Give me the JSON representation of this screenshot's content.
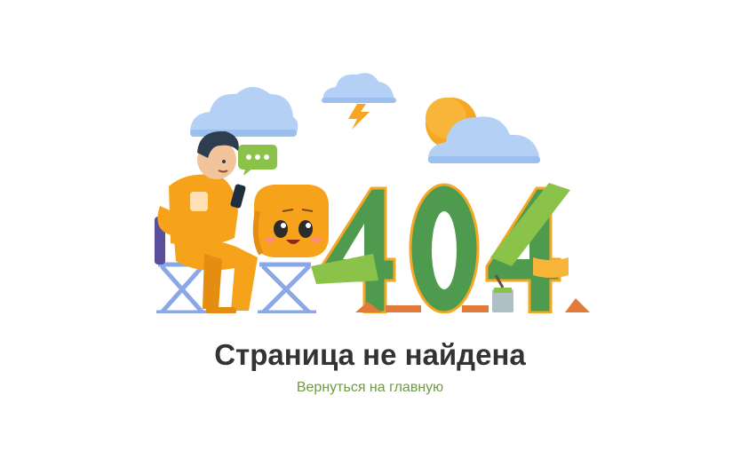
{
  "error": {
    "title": "Страница не найдена",
    "home_link_label": "Вернуться на главную"
  },
  "illustration": {
    "code_text": "404",
    "colors": {
      "accent_green": "#4e9a4f",
      "light_green": "#8bc34a",
      "orange": "#f7a21b",
      "cloud": "#b4d0f5",
      "sun": "#f5a623",
      "lightning": "#f5a623",
      "link": "#6f9a45",
      "title": "#333333"
    },
    "icons": [
      "cloud-icon",
      "lightning-icon",
      "sun-icon",
      "chat-bubble-icon",
      "phone-icon",
      "paint-bucket-icon"
    ]
  }
}
